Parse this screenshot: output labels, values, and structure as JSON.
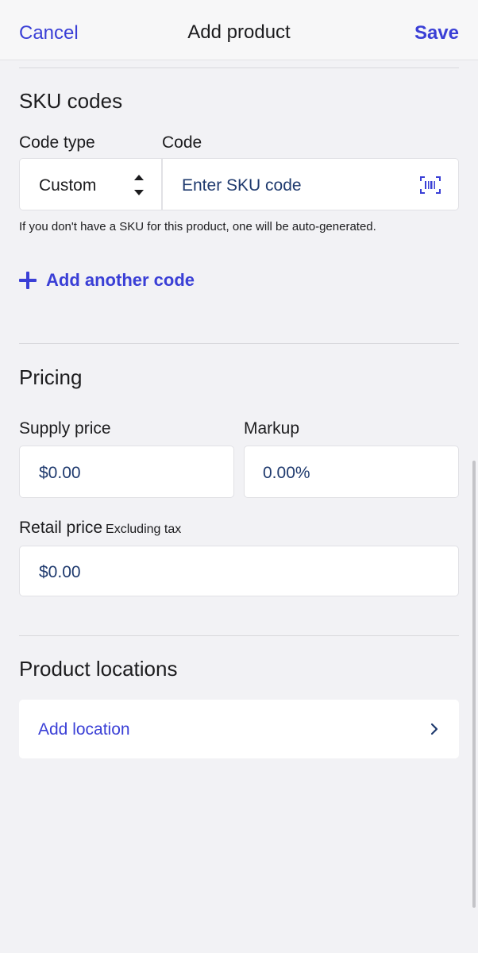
{
  "header": {
    "cancel_label": "Cancel",
    "title": "Add product",
    "save_label": "Save"
  },
  "sku": {
    "section_title": "SKU codes",
    "code_type_label": "Code type",
    "code_label": "Code",
    "code_type_value": "Custom",
    "code_placeholder": "Enter SKU code",
    "hint": "If you don't have a SKU for this product, one will be auto-generated.",
    "add_code_label": "Add another code"
  },
  "pricing": {
    "section_title": "Pricing",
    "supply_label": "Supply price",
    "supply_value": "$0.00",
    "markup_label": "Markup",
    "markup_value": "0.00%",
    "retail_label": "Retail price",
    "retail_sublabel": "Excluding tax",
    "retail_value": "$0.00"
  },
  "locations": {
    "section_title": "Product locations",
    "add_location_label": "Add location"
  },
  "icons": {
    "stepper": "up-down-arrows-icon",
    "barcode": "barcode-scan-icon",
    "plus": "plus-icon",
    "chevron": "chevron-right-icon"
  },
  "colors": {
    "accent": "#3a3fd6",
    "value_text": "#1f3a6e",
    "background": "#f2f2f5",
    "card": "#ffffff"
  }
}
